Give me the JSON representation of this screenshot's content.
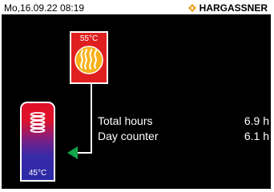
{
  "status_bar": {
    "datetime": "Mo,16.09.22 08:19",
    "brand": "HARGASSNER",
    "brand_logo_icon": "hargassner-diamond-logo"
  },
  "heater": {
    "temperature": "55°C",
    "icon": "flame-coils-icon",
    "color": "#e02020"
  },
  "buffer_tank": {
    "temperature": "45°C",
    "icon": "heating-coil-icon",
    "top_color": "#e0102a",
    "bottom_color": "#2a2aa8"
  },
  "flow": {
    "arrow_icon": "flow-arrow-left-icon",
    "arrow_color": "#11a64a"
  },
  "info": {
    "rows": [
      {
        "label": "Total hours",
        "value": "6.9 h"
      },
      {
        "label": "Day counter",
        "value": "6.1 h"
      }
    ]
  }
}
